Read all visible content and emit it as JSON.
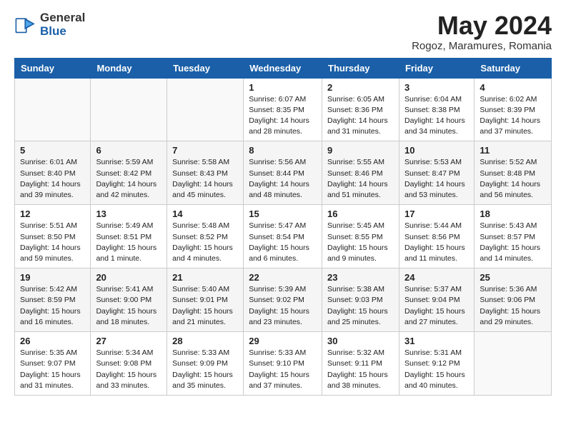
{
  "logo": {
    "general": "General",
    "blue": "Blue"
  },
  "title": {
    "month_year": "May 2024",
    "location": "Rogoz, Maramures, Romania"
  },
  "weekdays": [
    "Sunday",
    "Monday",
    "Tuesday",
    "Wednesday",
    "Thursday",
    "Friday",
    "Saturday"
  ],
  "weeks": [
    [
      {
        "num": "",
        "info": ""
      },
      {
        "num": "",
        "info": ""
      },
      {
        "num": "",
        "info": ""
      },
      {
        "num": "1",
        "info": "Sunrise: 6:07 AM\nSunset: 8:35 PM\nDaylight: 14 hours\nand 28 minutes."
      },
      {
        "num": "2",
        "info": "Sunrise: 6:05 AM\nSunset: 8:36 PM\nDaylight: 14 hours\nand 31 minutes."
      },
      {
        "num": "3",
        "info": "Sunrise: 6:04 AM\nSunset: 8:38 PM\nDaylight: 14 hours\nand 34 minutes."
      },
      {
        "num": "4",
        "info": "Sunrise: 6:02 AM\nSunset: 8:39 PM\nDaylight: 14 hours\nand 37 minutes."
      }
    ],
    [
      {
        "num": "5",
        "info": "Sunrise: 6:01 AM\nSunset: 8:40 PM\nDaylight: 14 hours\nand 39 minutes."
      },
      {
        "num": "6",
        "info": "Sunrise: 5:59 AM\nSunset: 8:42 PM\nDaylight: 14 hours\nand 42 minutes."
      },
      {
        "num": "7",
        "info": "Sunrise: 5:58 AM\nSunset: 8:43 PM\nDaylight: 14 hours\nand 45 minutes."
      },
      {
        "num": "8",
        "info": "Sunrise: 5:56 AM\nSunset: 8:44 PM\nDaylight: 14 hours\nand 48 minutes."
      },
      {
        "num": "9",
        "info": "Sunrise: 5:55 AM\nSunset: 8:46 PM\nDaylight: 14 hours\nand 51 minutes."
      },
      {
        "num": "10",
        "info": "Sunrise: 5:53 AM\nSunset: 8:47 PM\nDaylight: 14 hours\nand 53 minutes."
      },
      {
        "num": "11",
        "info": "Sunrise: 5:52 AM\nSunset: 8:48 PM\nDaylight: 14 hours\nand 56 minutes."
      }
    ],
    [
      {
        "num": "12",
        "info": "Sunrise: 5:51 AM\nSunset: 8:50 PM\nDaylight: 14 hours\nand 59 minutes."
      },
      {
        "num": "13",
        "info": "Sunrise: 5:49 AM\nSunset: 8:51 PM\nDaylight: 15 hours\nand 1 minute."
      },
      {
        "num": "14",
        "info": "Sunrise: 5:48 AM\nSunset: 8:52 PM\nDaylight: 15 hours\nand 4 minutes."
      },
      {
        "num": "15",
        "info": "Sunrise: 5:47 AM\nSunset: 8:54 PM\nDaylight: 15 hours\nand 6 minutes."
      },
      {
        "num": "16",
        "info": "Sunrise: 5:45 AM\nSunset: 8:55 PM\nDaylight: 15 hours\nand 9 minutes."
      },
      {
        "num": "17",
        "info": "Sunrise: 5:44 AM\nSunset: 8:56 PM\nDaylight: 15 hours\nand 11 minutes."
      },
      {
        "num": "18",
        "info": "Sunrise: 5:43 AM\nSunset: 8:57 PM\nDaylight: 15 hours\nand 14 minutes."
      }
    ],
    [
      {
        "num": "19",
        "info": "Sunrise: 5:42 AM\nSunset: 8:59 PM\nDaylight: 15 hours\nand 16 minutes."
      },
      {
        "num": "20",
        "info": "Sunrise: 5:41 AM\nSunset: 9:00 PM\nDaylight: 15 hours\nand 18 minutes."
      },
      {
        "num": "21",
        "info": "Sunrise: 5:40 AM\nSunset: 9:01 PM\nDaylight: 15 hours\nand 21 minutes."
      },
      {
        "num": "22",
        "info": "Sunrise: 5:39 AM\nSunset: 9:02 PM\nDaylight: 15 hours\nand 23 minutes."
      },
      {
        "num": "23",
        "info": "Sunrise: 5:38 AM\nSunset: 9:03 PM\nDaylight: 15 hours\nand 25 minutes."
      },
      {
        "num": "24",
        "info": "Sunrise: 5:37 AM\nSunset: 9:04 PM\nDaylight: 15 hours\nand 27 minutes."
      },
      {
        "num": "25",
        "info": "Sunrise: 5:36 AM\nSunset: 9:06 PM\nDaylight: 15 hours\nand 29 minutes."
      }
    ],
    [
      {
        "num": "26",
        "info": "Sunrise: 5:35 AM\nSunset: 9:07 PM\nDaylight: 15 hours\nand 31 minutes."
      },
      {
        "num": "27",
        "info": "Sunrise: 5:34 AM\nSunset: 9:08 PM\nDaylight: 15 hours\nand 33 minutes."
      },
      {
        "num": "28",
        "info": "Sunrise: 5:33 AM\nSunset: 9:09 PM\nDaylight: 15 hours\nand 35 minutes."
      },
      {
        "num": "29",
        "info": "Sunrise: 5:33 AM\nSunset: 9:10 PM\nDaylight: 15 hours\nand 37 minutes."
      },
      {
        "num": "30",
        "info": "Sunrise: 5:32 AM\nSunset: 9:11 PM\nDaylight: 15 hours\nand 38 minutes."
      },
      {
        "num": "31",
        "info": "Sunrise: 5:31 AM\nSunset: 9:12 PM\nDaylight: 15 hours\nand 40 minutes."
      },
      {
        "num": "",
        "info": ""
      }
    ]
  ]
}
